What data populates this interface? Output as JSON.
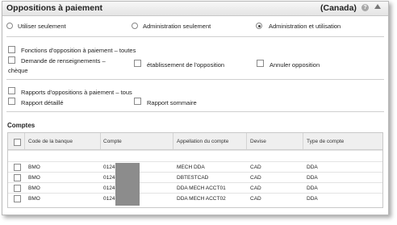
{
  "header": {
    "title": "Oppositions à paiement",
    "region": "(Canada)",
    "help_glyph": "?"
  },
  "access_options": [
    {
      "label": "Utiliser seulement",
      "checked": false
    },
    {
      "label": "Administration seulement",
      "checked": false
    },
    {
      "label": "Administration et utilisation",
      "checked": true
    }
  ],
  "functions": {
    "all": "Fonctions d'opposition à paiement – toutes",
    "inquiry_line1": "Demande de renseignements –",
    "inquiry_line2": "chèque",
    "establish": "établissement de l'opposition",
    "cancel": "Annuler opposition"
  },
  "reports": {
    "all": "Rapports d'oppositions à paiement – tous",
    "detailed": "Rapport détaillé",
    "summary": "Rapport sommaire"
  },
  "accounts": {
    "section_title": "Comptes",
    "columns": [
      "Code de la banque",
      "Compte",
      "Appellation du compte",
      "Devise",
      "Type de compte"
    ],
    "rows": [
      {
        "bank": "BMO",
        "account": "0124",
        "name": "MECH DDA",
        "currency": "CAD",
        "type": "DDA"
      },
      {
        "bank": "BMO",
        "account": "0124",
        "name": "DBTESTCAD",
        "currency": "CAD",
        "type": "DDA"
      },
      {
        "bank": "BMO",
        "account": "0124",
        "name": "DDA MECH ACCT01",
        "currency": "CAD",
        "type": "DDA"
      },
      {
        "bank": "BMO",
        "account": "0124",
        "name": "DDA MECH ACCT02",
        "currency": "CAD",
        "type": "DDA"
      }
    ]
  }
}
